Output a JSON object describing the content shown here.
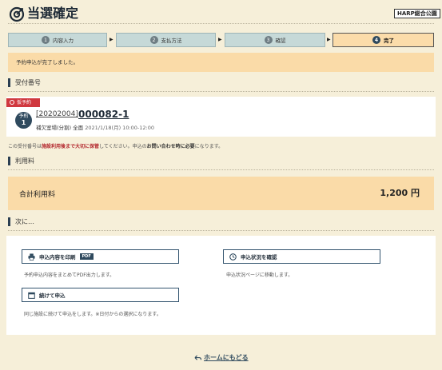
{
  "header": {
    "title": "当選確定",
    "org": "HARP総合公園"
  },
  "steps": [
    {
      "num": "1",
      "label": "内容入力"
    },
    {
      "num": "2",
      "label": "支払方法"
    },
    {
      "num": "3",
      "label": "確認"
    },
    {
      "num": "4",
      "label": "完了"
    }
  ],
  "banner": {
    "message": "予約申込が完了しました。"
  },
  "receipt": {
    "heading": "受付番号",
    "badge": "仮予約",
    "avatar_top": "予約",
    "avatar_bottom": "1",
    "code": "[20202004]",
    "number": "000082-1",
    "place": "補欠室場(分割) 全面",
    "datetime": "2021/1/18(月) 10:00-12:00",
    "note_pre": "この受付番号は",
    "note_em": "施設利用後まで大切に保管",
    "note_mid": "してください。申込の",
    "note_b": "お問い合わせ時に必要",
    "note_post": "になります。"
  },
  "fee": {
    "heading": "利用料",
    "label": "合計利用料",
    "value": "1,200 円"
  },
  "next": {
    "heading": "次に…",
    "print_label": "申込内容を印刷",
    "print_badge": "PDF",
    "print_desc": "予約申込内容をまとめてPDF出力します。",
    "status_label": "申込状況を確認",
    "status_desc": "申込状況ページに移動します。",
    "continue_label": "続けて申込",
    "continue_desc": "同じ施設に続けて申込をします。※日付からの選択になります。"
  },
  "home_link": "ホームにもどる",
  "colors": {
    "accent": "#2f4a5e",
    "banner": "#fadba8",
    "badge_red": "#d0383f",
    "background": "#f6efd9"
  }
}
